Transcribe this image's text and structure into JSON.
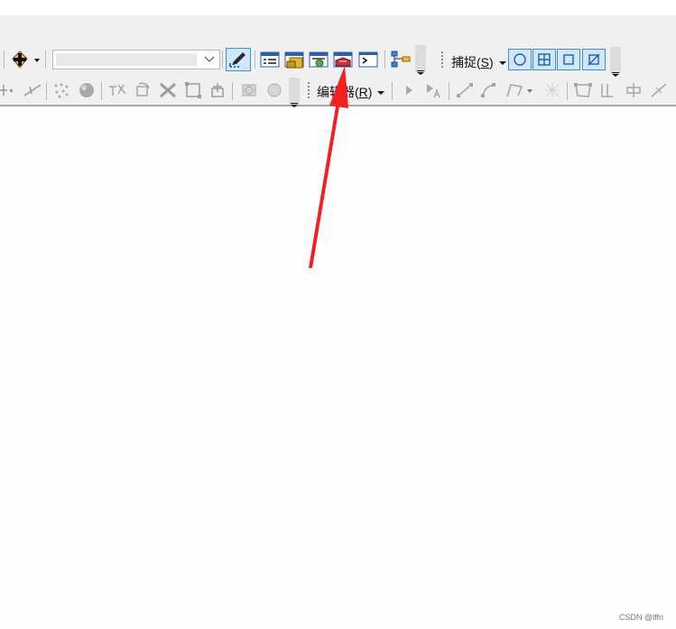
{
  "toolbar": {
    "add_data_icon": "add-data-icon",
    "combo_value": "",
    "snapping_menu_label": "捕捉",
    "snapping_menu_hotkey": "S",
    "editor_menu_label": "编辑器",
    "editor_menu_hotkey": "R",
    "paren_open": "(",
    "paren_close": ")"
  },
  "annotation": {
    "arrow_color": "#f3201f"
  },
  "watermark": "CSDN @lffn"
}
